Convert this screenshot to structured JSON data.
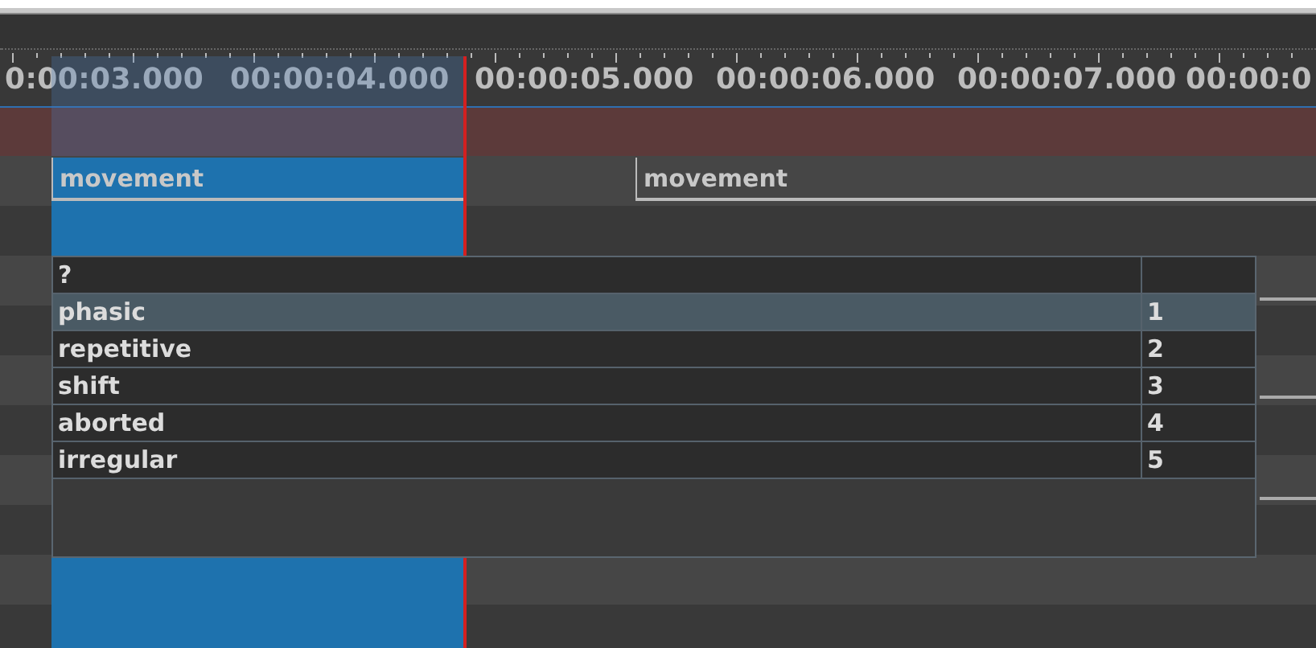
{
  "ruler": {
    "labels": [
      "0:00:03.000",
      "00:00:04.000",
      "00:00:05.000",
      "00:00:06.000",
      "00:00:07.000",
      "00:00:0"
    ]
  },
  "track": {
    "annotations": [
      {
        "label": "movement",
        "selected": true
      },
      {
        "label": "movement",
        "selected": false
      }
    ]
  },
  "popup": {
    "header": "?",
    "options": [
      {
        "label": "phasic",
        "key": "1",
        "selected": true
      },
      {
        "label": "repetitive",
        "key": "2",
        "selected": false
      },
      {
        "label": "shift",
        "key": "3",
        "selected": false
      },
      {
        "label": "aborted",
        "key": "4",
        "selected": false
      },
      {
        "label": "irregular",
        "key": "5",
        "selected": false
      }
    ]
  }
}
